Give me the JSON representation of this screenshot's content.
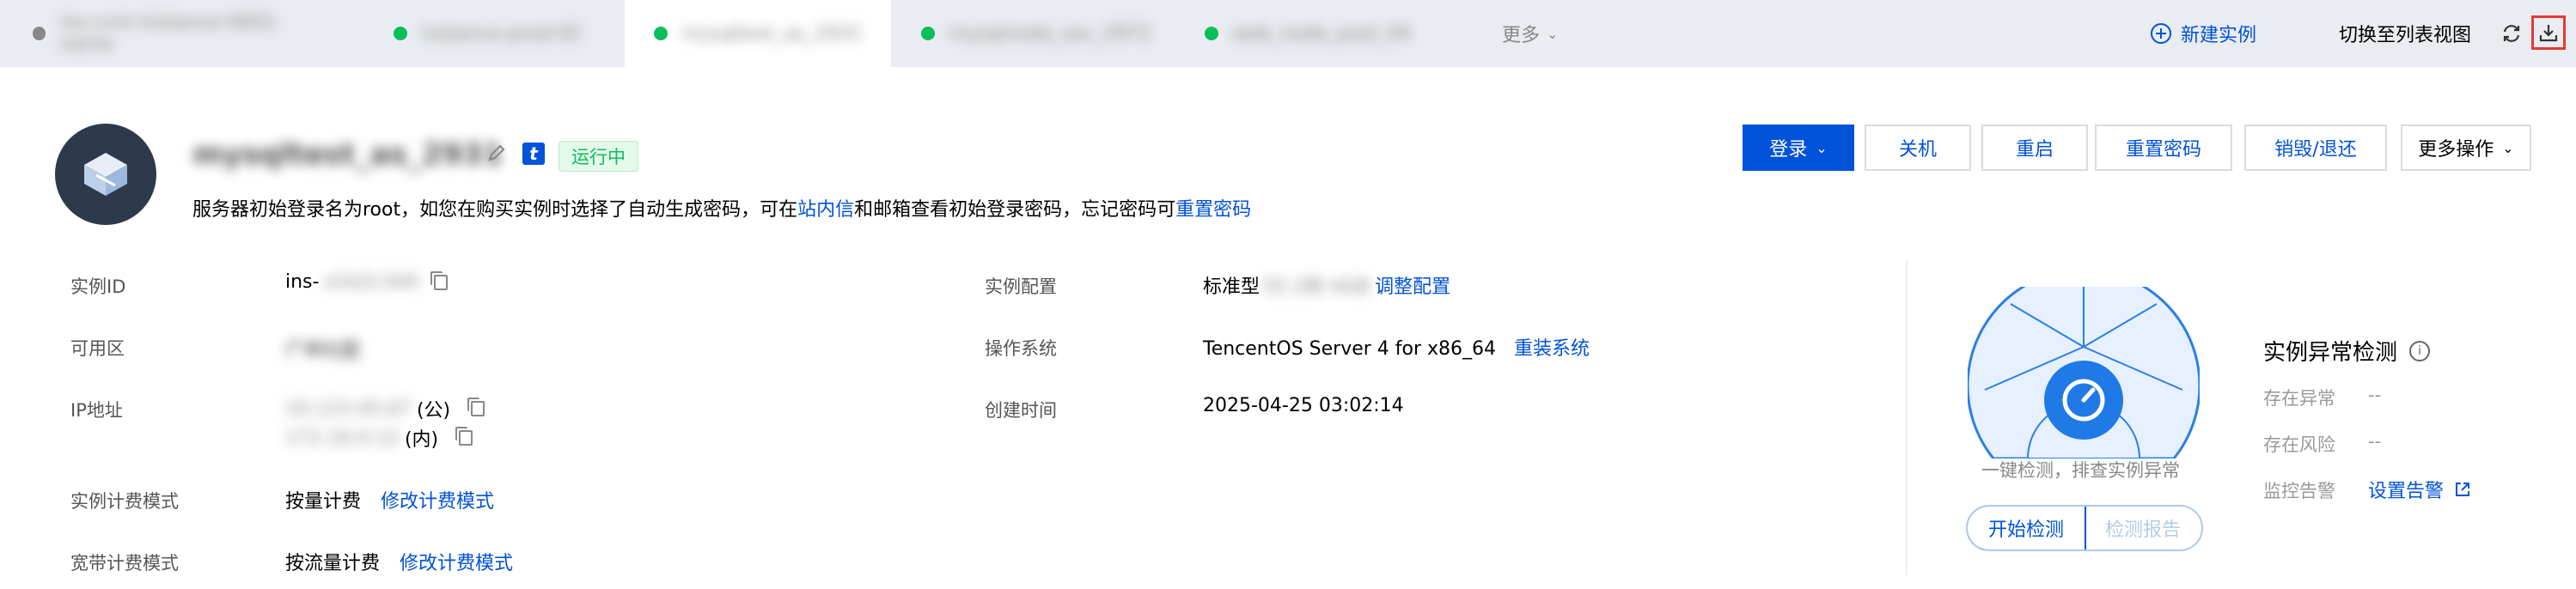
{
  "tabs": [
    {
      "label": "ins-cvm-instance-0001-name"
    },
    {
      "label": "instance-prod-02"
    },
    {
      "label": "mysqltest_as_2931"
    },
    {
      "label": "mysqlnode_sec_2972"
    },
    {
      "label": "web_node_pool_04"
    }
  ],
  "tabs_more": "更多",
  "header_actions": {
    "new_instance": "新建实例",
    "switch_list": "切换至列表视图"
  },
  "instance": {
    "name": "mysqltest_as_2931",
    "status": "运行中",
    "hint_prefix": "服务器初始登录名为root，如您在购买实例时选择了自动生成密码，可在",
    "hint_link1": "站内信",
    "hint_middle": "和邮箱查看初始登录密码，忘记密码可",
    "hint_link2": "重置密码"
  },
  "buttons": {
    "login": "登录",
    "shutdown": "关机",
    "restart": "重启",
    "reset_password": "重置密码",
    "destroy": "销毁/退还",
    "more": "更多操作"
  },
  "details": {
    "id_label": "实例ID",
    "id_value": "ins-",
    "id_hidden": "a1b2c3d4",
    "zone_label": "可用区",
    "zone_value": "广州七区",
    "ip_label": "IP地址",
    "ip_public": "10.123.45.67",
    "ip_public_suffix": "(公)",
    "ip_private": "172.16.0.12",
    "ip_private_suffix": "(内)",
    "billing_label": "实例计费模式",
    "billing_value": "按量计费",
    "billing_link": "修改计费模式",
    "bandwidth_label": "宽带计费模式",
    "bandwidth_value": "按流量计费",
    "bandwidth_link": "修改计费模式",
    "config_label": "实例配置",
    "config_value": "标准型",
    "config_hidden": "S5 2核 4GB",
    "config_link": "调整配置",
    "os_label": "操作系统",
    "os_value": "TencentOS Server 4 for x86_64",
    "os_link": "重装系统",
    "created_label": "创建时间",
    "created_value": "2025-04-25 03:02:14"
  },
  "detection": {
    "title": "实例异常检测",
    "gauge_caption": "一键检测，排查实例异常",
    "start_button": "开始检测",
    "report_button": "检测报告",
    "abnormal_label": "存在异常",
    "abnormal_value": "--",
    "risk_label": "存在风险",
    "risk_value": "--",
    "alarm_label": "监控告警",
    "alarm_link": "设置告警"
  },
  "colors": {
    "accent": "#0052d9",
    "running_green": "#0abf5b",
    "gauge_fill": "#e6f0ff",
    "gauge_stroke": "#2b7fe6",
    "highlight_red": "#e53935"
  }
}
